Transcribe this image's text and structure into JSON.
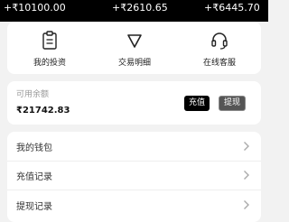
{
  "stats": [
    "+₹10100.00",
    "+₹2610.65",
    "+₹6445.70"
  ],
  "quick_actions": [
    {
      "label": "我的投资",
      "icon": "clipboard-icon"
    },
    {
      "label": "交易明细",
      "icon": "triangle-down-icon"
    },
    {
      "label": "在线客服",
      "icon": "headset-icon"
    }
  ],
  "balance": {
    "label": "可用余额",
    "value": "₹21742.83",
    "recharge_label": "充值",
    "withdraw_label": "提现"
  },
  "menu": [
    {
      "label": "我的钱包",
      "icon": "chevron-right-icon"
    },
    {
      "label": "充值记录",
      "icon": "chevron-right-icon"
    },
    {
      "label": "提现记录",
      "icon": "chevron-right-icon"
    }
  ],
  "colors": {
    "accent": "#000000",
    "background": "#f2f2f2",
    "card": "#ffffff",
    "muted": "#999999"
  }
}
